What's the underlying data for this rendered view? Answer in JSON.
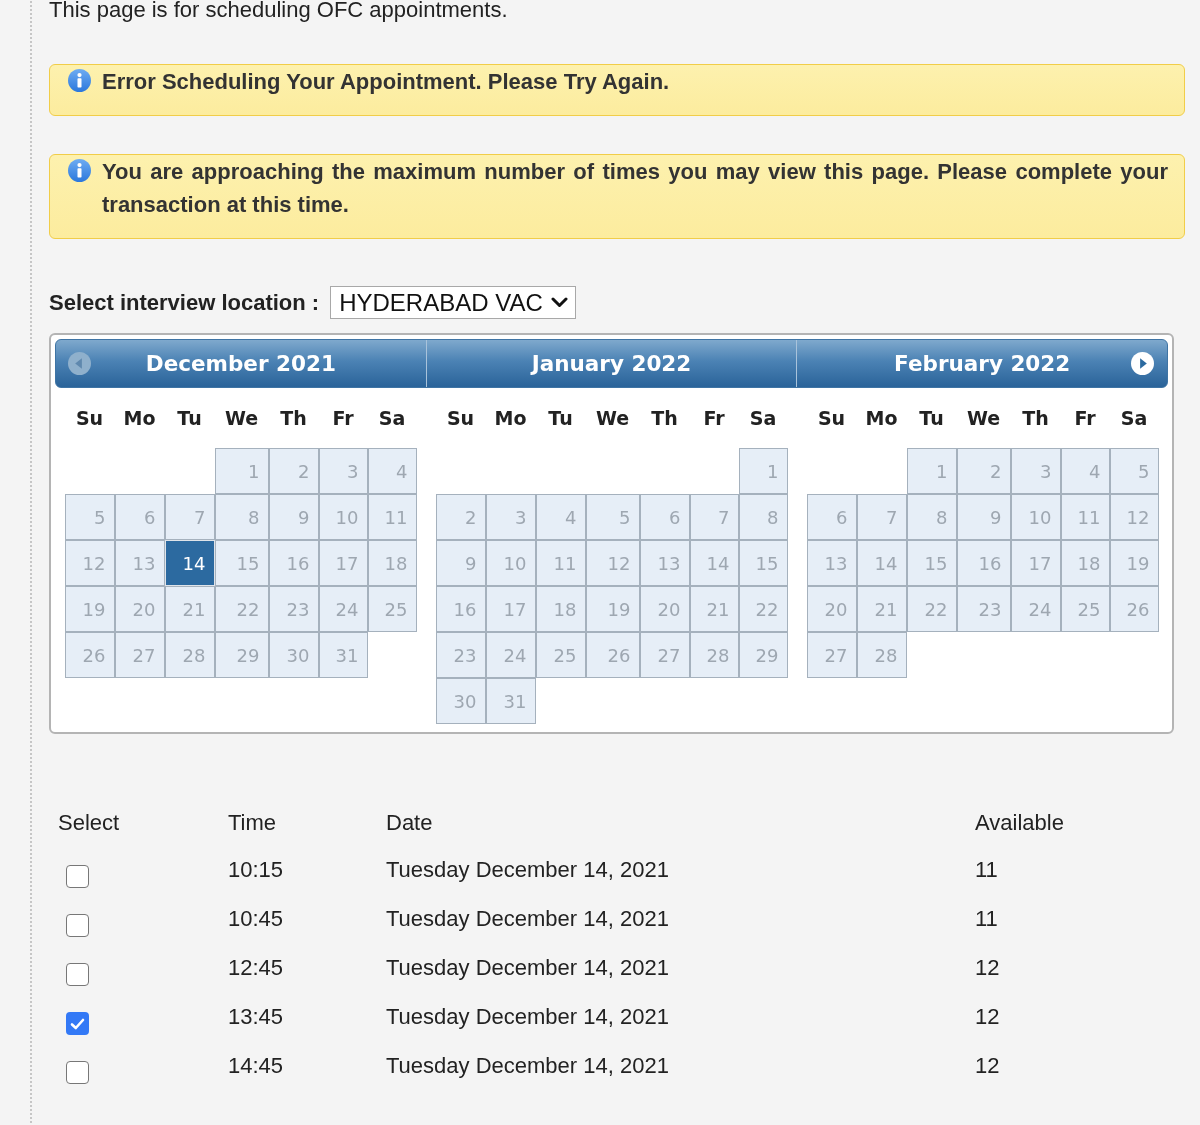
{
  "intro": "This page is for scheduling OFC appointments.",
  "alerts": [
    "Error Scheduling Your Appointment. Please Try Again.",
    "You are approaching the maximum number of times you may view this page. Please complete your transaction at this time."
  ],
  "location": {
    "label": "Select interview location :",
    "value": "HYDERABAD VAC"
  },
  "calendar": {
    "prev": {
      "disabled": true
    },
    "next": {
      "disabled": false
    },
    "months": [
      {
        "title": "December 2021",
        "weekdays": [
          "Su",
          "Mo",
          "Tu",
          "We",
          "Th",
          "Fr",
          "Sa"
        ],
        "weeks": [
          [
            {
              "label": "1",
              "selected": false
            },
            {
              "label": "2",
              "selected": false
            },
            {
              "label": "3",
              "selected": false
            },
            {
              "label": "4",
              "selected": false
            }
          ],
          [
            {
              "label": "5",
              "selected": false
            },
            {
              "label": "6",
              "selected": false
            },
            {
              "label": "7",
              "selected": false
            },
            {
              "label": "8",
              "selected": false
            },
            {
              "label": "9",
              "selected": false
            },
            {
              "label": "10",
              "selected": false
            },
            {
              "label": "11",
              "selected": false
            }
          ],
          [
            {
              "label": "12",
              "selected": false
            },
            {
              "label": "13",
              "selected": false
            },
            {
              "label": "14",
              "selected": true
            },
            {
              "label": "15",
              "selected": false
            },
            {
              "label": "16",
              "selected": false
            },
            {
              "label": "17",
              "selected": false
            },
            {
              "label": "18",
              "selected": false
            }
          ],
          [
            {
              "label": "19",
              "selected": false
            },
            {
              "label": "20",
              "selected": false
            },
            {
              "label": "21",
              "selected": false
            },
            {
              "label": "22",
              "selected": false
            },
            {
              "label": "23",
              "selected": false
            },
            {
              "label": "24",
              "selected": false
            },
            {
              "label": "25",
              "selected": false
            }
          ],
          [
            {
              "label": "26",
              "selected": false
            },
            {
              "label": "27",
              "selected": false
            },
            {
              "label": "28",
              "selected": false
            },
            {
              "label": "29",
              "selected": false
            },
            {
              "label": "30",
              "selected": false
            },
            {
              "label": "31",
              "selected": false
            }
          ]
        ]
      },
      {
        "title": "January 2022",
        "weekdays": [
          "Su",
          "Mo",
          "Tu",
          "We",
          "Th",
          "Fr",
          "Sa"
        ],
        "weeks": [
          [
            {
              "label": "1",
              "selected": false
            }
          ],
          [
            {
              "label": "2",
              "selected": false
            },
            {
              "label": "3",
              "selected": false
            },
            {
              "label": "4",
              "selected": false
            },
            {
              "label": "5",
              "selected": false
            },
            {
              "label": "6",
              "selected": false
            },
            {
              "label": "7",
              "selected": false
            },
            {
              "label": "8",
              "selected": false
            }
          ],
          [
            {
              "label": "9",
              "selected": false
            },
            {
              "label": "10",
              "selected": false
            },
            {
              "label": "11",
              "selected": false
            },
            {
              "label": "12",
              "selected": false
            },
            {
              "label": "13",
              "selected": false
            },
            {
              "label": "14",
              "selected": false
            },
            {
              "label": "15",
              "selected": false
            }
          ],
          [
            {
              "label": "16",
              "selected": false
            },
            {
              "label": "17",
              "selected": false
            },
            {
              "label": "18",
              "selected": false
            },
            {
              "label": "19",
              "selected": false
            },
            {
              "label": "20",
              "selected": false
            },
            {
              "label": "21",
              "selected": false
            },
            {
              "label": "22",
              "selected": false
            }
          ],
          [
            {
              "label": "23",
              "selected": false
            },
            {
              "label": "24",
              "selected": false
            },
            {
              "label": "25",
              "selected": false
            },
            {
              "label": "26",
              "selected": false
            },
            {
              "label": "27",
              "selected": false
            },
            {
              "label": "28",
              "selected": false
            },
            {
              "label": "29",
              "selected": false
            }
          ],
          [
            {
              "label": "30",
              "selected": false
            },
            {
              "label": "31",
              "selected": false
            }
          ]
        ]
      },
      {
        "title": "February 2022",
        "weekdays": [
          "Su",
          "Mo",
          "Tu",
          "We",
          "Th",
          "Fr",
          "Sa"
        ],
        "weeks": [
          [
            {
              "label": "1",
              "selected": false
            },
            {
              "label": "2",
              "selected": false
            },
            {
              "label": "3",
              "selected": false
            },
            {
              "label": "4",
              "selected": false
            },
            {
              "label": "5",
              "selected": false
            }
          ],
          [
            {
              "label": "6",
              "selected": false
            },
            {
              "label": "7",
              "selected": false
            },
            {
              "label": "8",
              "selected": false
            },
            {
              "label": "9",
              "selected": false
            },
            {
              "label": "10",
              "selected": false
            },
            {
              "label": "11",
              "selected": false
            },
            {
              "label": "12",
              "selected": false
            }
          ],
          [
            {
              "label": "13",
              "selected": false
            },
            {
              "label": "14",
              "selected": false
            },
            {
              "label": "15",
              "selected": false
            },
            {
              "label": "16",
              "selected": false
            },
            {
              "label": "17",
              "selected": false
            },
            {
              "label": "18",
              "selected": false
            },
            {
              "label": "19",
              "selected": false
            }
          ],
          [
            {
              "label": "20",
              "selected": false
            },
            {
              "label": "21",
              "selected": false
            },
            {
              "label": "22",
              "selected": false
            },
            {
              "label": "23",
              "selected": false
            },
            {
              "label": "24",
              "selected": false
            },
            {
              "label": "25",
              "selected": false
            },
            {
              "label": "26",
              "selected": false
            }
          ],
          [
            {
              "label": "27",
              "selected": false
            },
            {
              "label": "28",
              "selected": false
            }
          ]
        ]
      }
    ]
  },
  "slots": {
    "columns": [
      "Select",
      "Time",
      "Date",
      "Available"
    ],
    "rows": [
      {
        "checked": false,
        "time": "10:15",
        "date": "Tuesday December 14, 2021",
        "available": "11"
      },
      {
        "checked": false,
        "time": "10:45",
        "date": "Tuesday December 14, 2021",
        "available": "11"
      },
      {
        "checked": false,
        "time": "12:45",
        "date": "Tuesday December 14, 2021",
        "available": "12"
      },
      {
        "checked": true,
        "time": "13:45",
        "date": "Tuesday December 14, 2021",
        "available": "12"
      },
      {
        "checked": false,
        "time": "14:45",
        "date": "Tuesday December 14, 2021",
        "available": "12"
      }
    ]
  }
}
